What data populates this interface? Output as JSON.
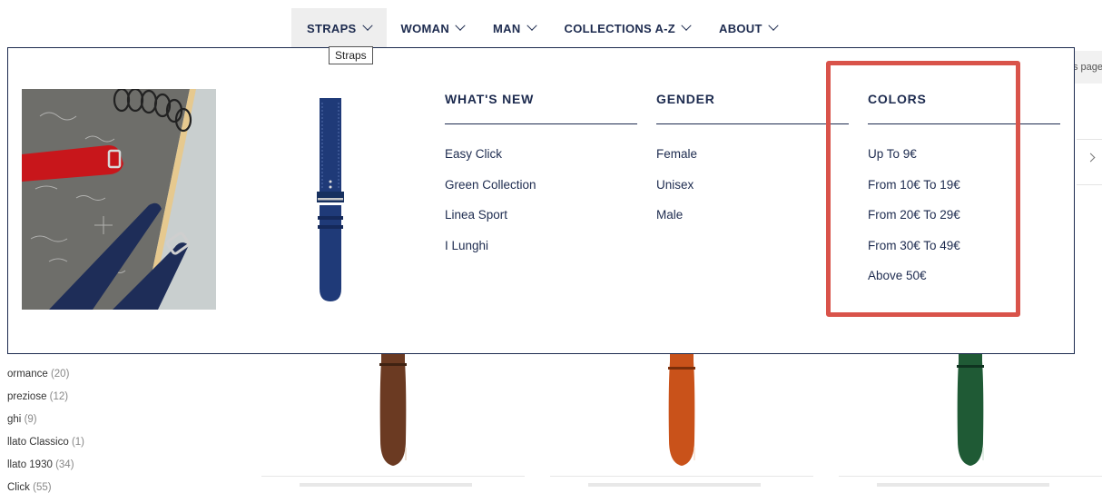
{
  "nav": {
    "items": [
      {
        "label": "STRAPS"
      },
      {
        "label": "WOMAN"
      },
      {
        "label": "MAN"
      },
      {
        "label": "COLLECTIONS A-Z"
      },
      {
        "label": "ABOUT"
      }
    ],
    "tooltip": "Straps"
  },
  "menu": {
    "columns": [
      {
        "title": "WHAT'S NEW",
        "links": [
          "Easy Click",
          "Green Collection",
          "Linea Sport",
          "I Lunghi"
        ]
      },
      {
        "title": "GENDER",
        "links": [
          "Female",
          "Unisex",
          "Male"
        ]
      },
      {
        "title": "COLORS",
        "links": [
          "Up To 9€",
          "From 10€ To 19€",
          "From 20€ To 29€",
          "From 30€ To 49€",
          "Above 50€"
        ]
      }
    ]
  },
  "page": {
    "right_pill_fragment": "s page"
  },
  "sidebar": {
    "items": [
      {
        "label": "ormance",
        "count": "(20)"
      },
      {
        "label": "preziose",
        "count": "(12)"
      },
      {
        "label": "ghi",
        "count": "(9)"
      },
      {
        "label": "llato Classico",
        "count": "(1)"
      },
      {
        "label": "llato 1930",
        "count": "(34)"
      },
      {
        "label": "Click",
        "count": "(55)"
      }
    ]
  },
  "products": [
    {
      "strap_color": "#6b3a22"
    },
    {
      "strap_color": "#c9521a"
    },
    {
      "strap_color": "#1f5a35"
    }
  ],
  "colors": {
    "brand": "#1d2b4f",
    "highlight": "#d9534a",
    "active_nav_bg": "#eeeeee"
  }
}
